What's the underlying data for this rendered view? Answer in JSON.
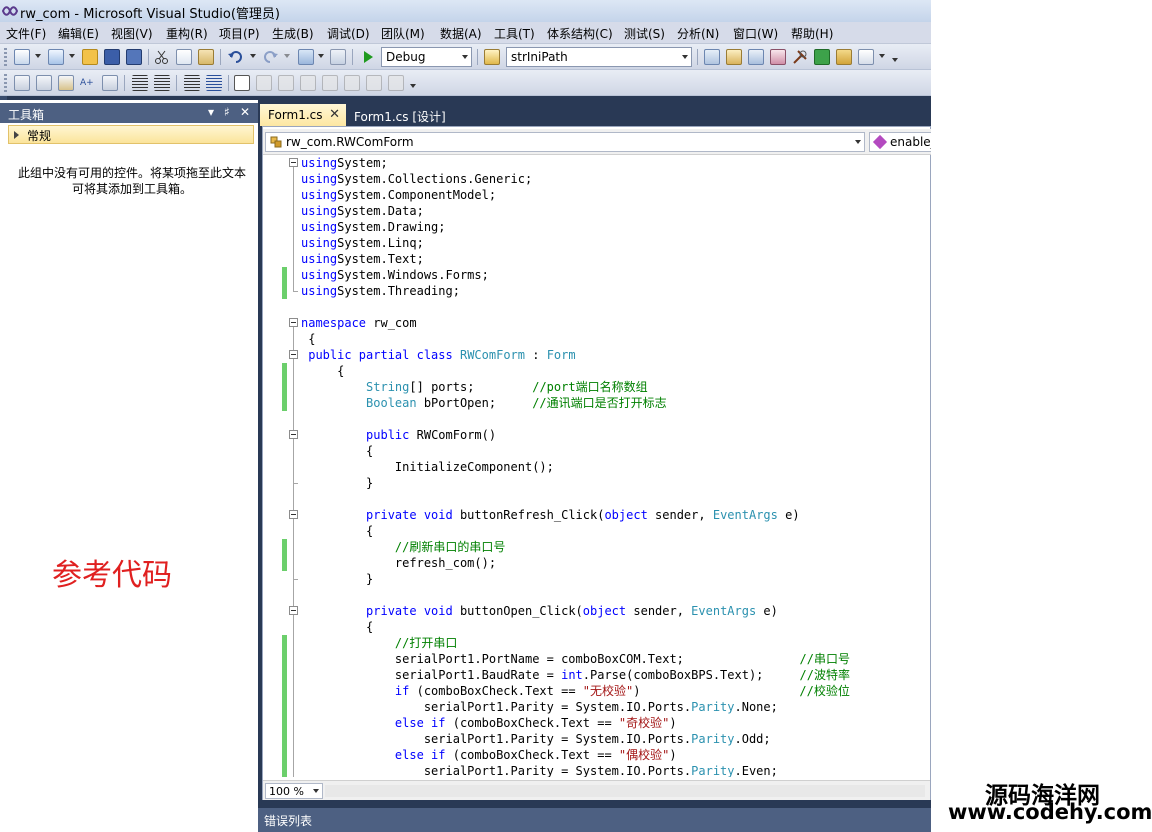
{
  "window": {
    "title": "rw_com - Microsoft Visual Studio(管理员)"
  },
  "menu": [
    "文件(F)",
    "编辑(E)",
    "视图(V)",
    "重构(R)",
    "项目(P)",
    "生成(B)",
    "调试(D)",
    "团队(M)",
    "数据(A)",
    "工具(T)",
    "体系结构(C)",
    "测试(S)",
    "分析(N)",
    "窗口(W)",
    "帮助(H)"
  ],
  "toolbar": {
    "config": "Debug",
    "find_text": "strIniPath"
  },
  "toolbox": {
    "title": "工具箱",
    "pin": "▾ ♯ ✕",
    "group": "常规",
    "empty_message": "此组中没有可用的控件。将某项拖至此文本可将其添加到工具箱。"
  },
  "tabs": [
    "Form1.cs",
    "Form1.cs [设计]"
  ],
  "nav": {
    "class": "rw_com.RWComForm",
    "member": "enable_"
  },
  "code": [
    [
      [
        "kw",
        "using"
      ],
      [
        "",
        "System;"
      ]
    ],
    [
      [
        "kw",
        "using"
      ],
      [
        "",
        "System.Collections.Generic;"
      ]
    ],
    [
      [
        "kw",
        "using"
      ],
      [
        "",
        "System.ComponentModel;"
      ]
    ],
    [
      [
        "kw",
        "using"
      ],
      [
        "",
        "System.Data;"
      ]
    ],
    [
      [
        "kw",
        "using"
      ],
      [
        "",
        "System.Drawing;"
      ]
    ],
    [
      [
        "kw",
        "using"
      ],
      [
        "",
        "System.Linq;"
      ]
    ],
    [
      [
        "kw",
        "using"
      ],
      [
        "",
        "System.Text;"
      ]
    ],
    [
      [
        "kw",
        "using"
      ],
      [
        "",
        "System.Windows.Forms;"
      ]
    ],
    [
      [
        "kw",
        "using"
      ],
      [
        "",
        "System.Threading;"
      ]
    ],
    [],
    [
      [
        "kw",
        "namespace"
      ],
      [
        "",
        " rw_com"
      ]
    ],
    [
      [
        "",
        " {"
      ]
    ],
    [
      [
        "",
        " "
      ],
      [
        "kw",
        "public partial class"
      ],
      [
        "",
        " "
      ],
      [
        "ty",
        "RWComForm"
      ],
      [
        "",
        " : "
      ],
      [
        "ty",
        "Form"
      ]
    ],
    [
      [
        "",
        "     {"
      ]
    ],
    [
      [
        "",
        "         "
      ],
      [
        "ty",
        "String"
      ],
      [
        "",
        "[] ports;        "
      ],
      [
        "cm",
        "//port端口名称数组"
      ]
    ],
    [
      [
        "",
        "         "
      ],
      [
        "ty",
        "Boolean"
      ],
      [
        "",
        " bPortOpen;     "
      ],
      [
        "cm",
        "//通讯端口是否打开标志"
      ]
    ],
    [],
    [
      [
        "",
        "         "
      ],
      [
        "kw",
        "public"
      ],
      [
        "",
        " RWComForm()"
      ]
    ],
    [
      [
        "",
        "         {"
      ]
    ],
    [
      [
        "",
        "             InitializeComponent();"
      ]
    ],
    [
      [
        "",
        "         }"
      ]
    ],
    [],
    [
      [
        "",
        "         "
      ],
      [
        "kw",
        "private void"
      ],
      [
        "",
        " buttonRefresh_Click("
      ],
      [
        "kw",
        "object"
      ],
      [
        "",
        " sender, "
      ],
      [
        "ty",
        "EventArgs"
      ],
      [
        "",
        " e)"
      ]
    ],
    [
      [
        "",
        "         {"
      ]
    ],
    [
      [
        "",
        "             "
      ],
      [
        "cm",
        "//刷新串口的串口号"
      ]
    ],
    [
      [
        "",
        "             refresh_com();"
      ]
    ],
    [
      [
        "",
        "         }"
      ]
    ],
    [],
    [
      [
        "",
        "         "
      ],
      [
        "kw",
        "private void"
      ],
      [
        "",
        " buttonOpen_Click("
      ],
      [
        "kw",
        "object"
      ],
      [
        "",
        " sender, "
      ],
      [
        "ty",
        "EventArgs"
      ],
      [
        "",
        " e)"
      ]
    ],
    [
      [
        "",
        "         {"
      ]
    ],
    [
      [
        "",
        "             "
      ],
      [
        "cm",
        "//打开串口"
      ]
    ],
    [
      [
        "",
        "             serialPort1.PortName = comboBoxCOM.Text;                "
      ],
      [
        "cm",
        "//串口号"
      ]
    ],
    [
      [
        "",
        "             serialPort1.BaudRate = "
      ],
      [
        "kw",
        "int"
      ],
      [
        "",
        ".Parse(comboBoxBPS.Text);     "
      ],
      [
        "cm",
        "//波特率"
      ]
    ],
    [
      [
        "",
        "             "
      ],
      [
        "kw",
        "if"
      ],
      [
        "",
        " (comboBoxCheck.Text == "
      ],
      [
        "st",
        "\"无校验\""
      ],
      [
        "",
        ")                      "
      ],
      [
        "cm",
        "//校验位"
      ]
    ],
    [
      [
        "",
        "                 serialPort1.Parity = System.IO.Ports."
      ],
      [
        "ty",
        "Parity"
      ],
      [
        "",
        ".None;"
      ]
    ],
    [
      [
        "",
        "             "
      ],
      [
        "kw",
        "else if"
      ],
      [
        "",
        " (comboBoxCheck.Text == "
      ],
      [
        "st",
        "\"奇校验\""
      ],
      [
        "",
        ")"
      ]
    ],
    [
      [
        "",
        "                 serialPort1.Parity = System.IO.Ports."
      ],
      [
        "ty",
        "Parity"
      ],
      [
        "",
        ".Odd;"
      ]
    ],
    [
      [
        "",
        "             "
      ],
      [
        "kw",
        "else if"
      ],
      [
        "",
        " (comboBoxCheck.Text == "
      ],
      [
        "st",
        "\"偶校验\""
      ],
      [
        "",
        ")"
      ]
    ],
    [
      [
        "",
        "                 serialPort1.Parity = System.IO.Ports."
      ],
      [
        "ty",
        "Parity"
      ],
      [
        "",
        ".Even;"
      ]
    ]
  ],
  "zoom": "100 %",
  "error_list": "错误列表",
  "overlay": {
    "ref_label": "参考代码",
    "watermark_cn": "源码海洋网",
    "watermark_url": "www.codehy.com"
  }
}
